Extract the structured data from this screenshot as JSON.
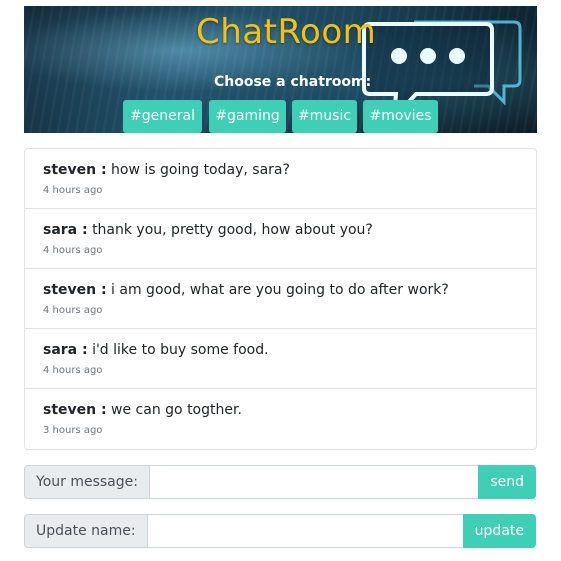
{
  "header": {
    "title": "ChatRoom",
    "choose_label": "Choose a chatroom:",
    "rooms": [
      "#general",
      "#gaming",
      "#music",
      "#movies"
    ]
  },
  "messages": [
    {
      "user": "steven :",
      "text": "how is going today, sara?",
      "time": "4 hours ago"
    },
    {
      "user": "sara :",
      "text": "thank you, pretty good, how about you?",
      "time": "4 hours ago"
    },
    {
      "user": "steven :",
      "text": "i am good, what are you going to do after work?",
      "time": "4 hours ago"
    },
    {
      "user": "sara :",
      "text": "i'd like to buy some food.",
      "time": "4 hours ago"
    },
    {
      "user": "steven :",
      "text": "we can go togther.",
      "time": "3 hours ago"
    }
  ],
  "message_form": {
    "label": "Your message:",
    "value": "",
    "button": "send"
  },
  "name_form": {
    "label": "Update name:",
    "value": "",
    "button": "update"
  },
  "colors": {
    "accent": "#3ecfb6",
    "title": "#f4c20d",
    "icon": "#5fd3f3"
  }
}
